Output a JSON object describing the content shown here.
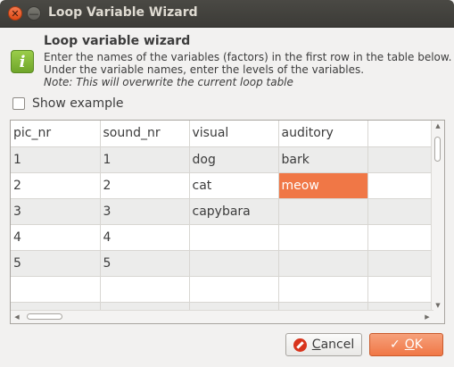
{
  "window": {
    "title": "Loop Variable Wizard"
  },
  "header": {
    "title": "Loop variable wizard",
    "line1": "Enter the names of the variables (factors) in the first row in the table below.",
    "line2": "Under the variable names, enter the levels of the variables.",
    "note": "Note: This will overwrite the current loop table"
  },
  "show_example": {
    "label": "Show example",
    "checked": false
  },
  "table": {
    "rows": [
      [
        "pic_nr",
        "sound_nr",
        "visual",
        "auditory",
        ""
      ],
      [
        "1",
        "1",
        "dog",
        "bark",
        ""
      ],
      [
        "2",
        "2",
        "cat",
        "meow",
        ""
      ],
      [
        "3",
        "3",
        "capybara",
        "",
        ""
      ],
      [
        "4",
        "4",
        "",
        "",
        ""
      ],
      [
        "5",
        "5",
        "",
        "",
        ""
      ],
      [
        "",
        "",
        "",
        "",
        ""
      ],
      [
        "",
        "",
        "",
        "",
        ""
      ]
    ],
    "selected_cell": {
      "row": 2,
      "col": 3
    }
  },
  "buttons": {
    "cancel_label_pre": "",
    "cancel_label_u": "C",
    "cancel_label_post": "ancel",
    "ok_label_u": "O",
    "ok_label_post": "K"
  },
  "colors": {
    "accent": "#f07746",
    "titlebar": "#3c3b37",
    "info_icon": "#7fb536"
  }
}
